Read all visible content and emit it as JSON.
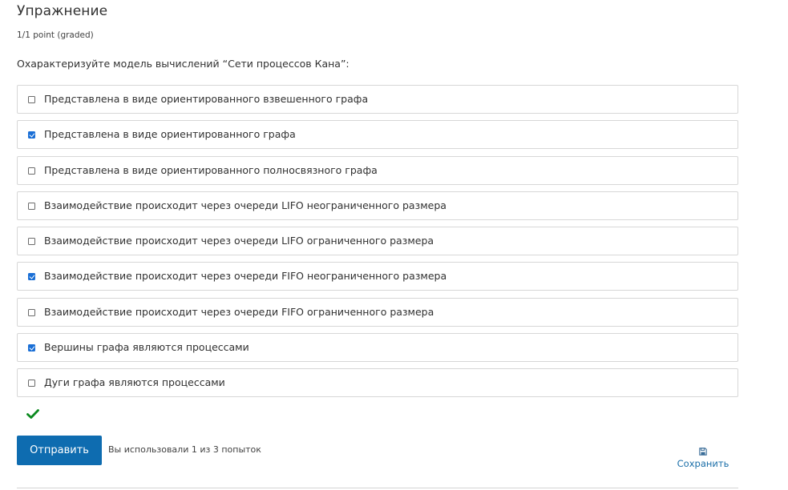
{
  "problem": {
    "title": "Упражнение",
    "points": "1/1 point (graded)",
    "prompt": "Охарактеризуйте модель вычислений “Сети процессов Кана”:"
  },
  "choices": [
    {
      "label": "Представлена в виде ориентированного взвешенного графа",
      "checked": false
    },
    {
      "label": "Представлена в виде ориентированного графа",
      "checked": true
    },
    {
      "label": "Представлена в виде ориентированного полносвязного графа",
      "checked": false
    },
    {
      "label": "Взаимодействие происходит через очереди LIFO неограниченного размера",
      "checked": false
    },
    {
      "label": "Взаимодействие происходит через очереди LIFO ограниченного размера",
      "checked": false
    },
    {
      "label": "Взаимодействие происходит через очереди FIFO неограниченного размера",
      "checked": true
    },
    {
      "label": "Взаимодействие происходит через очереди FIFO ограниченного размера",
      "checked": false
    },
    {
      "label": "Вершины графа являются процессами",
      "checked": true
    },
    {
      "label": "Дуги графа являются процессами",
      "checked": false
    }
  ],
  "status": {
    "icon": "checkmark-icon",
    "color": "#0b8a1f"
  },
  "actions": {
    "submit_label": "Отправить",
    "attempts_text": "Вы использовали 1 из 3 попыток",
    "save_label": "Сохранить",
    "save_icon": "floppy-disk-icon"
  },
  "colors": {
    "accent": "#0e6cb0",
    "checkbox_checked": "#1a6fd6",
    "link": "#1a6ea8"
  }
}
